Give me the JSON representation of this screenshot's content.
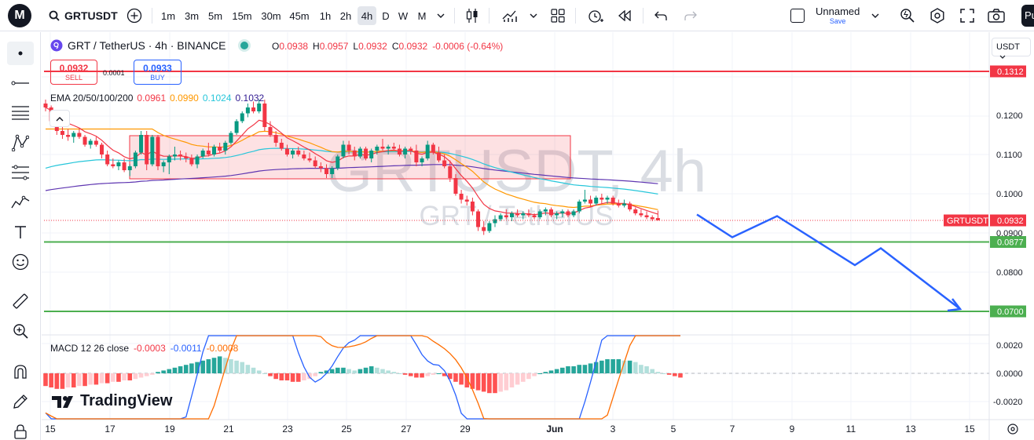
{
  "toolbar": {
    "logo": "M",
    "symbol": "GRTUSDT",
    "intervals": [
      "1m",
      "3m",
      "5m",
      "15m",
      "30m",
      "45m",
      "1h",
      "2h",
      "4h",
      "D",
      "W",
      "M"
    ],
    "active_interval": "4h",
    "layout_name": "Unnamed",
    "layout_status": "Save",
    "publish_label": "Pu"
  },
  "legend": {
    "title": "GRT / TetherUS · 4h · BINANCE",
    "open_label": "O",
    "open": "0.0938",
    "high_label": "H",
    "high": "0.0957",
    "low_label": "L",
    "low": "0.0932",
    "close_label": "C",
    "close": "0.0932",
    "change": "-0.0006 (-0.64%)"
  },
  "trade": {
    "sell_price": "0.0932",
    "sell_label": "SELL",
    "spread": "0.0001",
    "buy_price": "0.0933",
    "buy_label": "BUY"
  },
  "ema": {
    "label": "EMA 20/50/100/200",
    "v20": "0.0961",
    "v50": "0.0990",
    "v100": "0.1024",
    "v200": "0.1032",
    "colors": {
      "ema20": "#f23645",
      "ema50": "#ff9800",
      "ema100": "#26c6da",
      "ema200": "#5e35b1"
    }
  },
  "macd": {
    "label": "MACD 12 26 close",
    "hist": "-0.0003",
    "macd": "-0.0011",
    "signal": "-0.0008",
    "scale_labels": [
      "0.0020",
      "0.0000",
      "-0.0020"
    ]
  },
  "price_scale": {
    "currency": "USDT",
    "ticks": [
      "0.1200",
      "0.1100",
      "0.1000",
      "0.0900",
      "0.0800"
    ],
    "level_red": "0.1312",
    "level_green_1": "0.0877",
    "level_green_2": "0.0700",
    "current_symbol": "GRTUSDT",
    "current_price": "0.0932"
  },
  "time_axis": [
    "15",
    "17",
    "19",
    "21",
    "23",
    "25",
    "27",
    "29",
    "Jun",
    "3",
    "5",
    "7",
    "9",
    "11",
    "13",
    "15"
  ],
  "watermark": {
    "big": "GRTUSDT, 4h",
    "small": "GRT / TetherUS"
  },
  "branding": "TradingView",
  "colors": {
    "up": "#089981",
    "down": "#f23645",
    "level_red": "#f23645",
    "level_green": "#4caf50",
    "projection": "#2962ff"
  },
  "chart_data": {
    "type": "candlestick",
    "title": "GRT / TetherUS · 4h · BINANCE",
    "ylim": [
      0.0695,
      0.1325
    ],
    "horizontal_levels": [
      0.1312,
      0.0877,
      0.07
    ],
    "candles": [
      [
        0.123,
        0.124,
        0.121,
        0.122
      ],
      [
        0.122,
        0.1225,
        0.118,
        0.1185
      ],
      [
        0.1185,
        0.1195,
        0.115,
        0.116
      ],
      [
        0.116,
        0.1175,
        0.114,
        0.115
      ],
      [
        0.115,
        0.1165,
        0.1135,
        0.1145
      ],
      [
        0.1145,
        0.116,
        0.113,
        0.1155
      ],
      [
        0.1155,
        0.1165,
        0.114,
        0.1145
      ],
      [
        0.1145,
        0.115,
        0.112,
        0.1125
      ],
      [
        0.1125,
        0.114,
        0.1115,
        0.1135
      ],
      [
        0.1135,
        0.1145,
        0.112,
        0.1125
      ],
      [
        0.1125,
        0.113,
        0.109,
        0.11
      ],
      [
        0.11,
        0.111,
        0.107,
        0.1075
      ],
      [
        0.1075,
        0.109,
        0.1065,
        0.107
      ],
      [
        0.107,
        0.1085,
        0.106,
        0.108
      ],
      [
        0.108,
        0.109,
        0.1055,
        0.106
      ],
      [
        0.106,
        0.1075,
        0.1045,
        0.107
      ],
      [
        0.107,
        0.111,
        0.1065,
        0.1105
      ],
      [
        0.1105,
        0.116,
        0.11,
        0.115
      ],
      [
        0.115,
        0.116,
        0.106,
        0.1075
      ],
      [
        0.1075,
        0.115,
        0.107,
        0.1145
      ],
      [
        0.1145,
        0.115,
        0.106,
        0.107
      ],
      [
        0.107,
        0.1085,
        0.1055,
        0.108
      ],
      [
        0.108,
        0.11,
        0.105,
        0.1095
      ],
      [
        0.1095,
        0.112,
        0.1085,
        0.11
      ],
      [
        0.11,
        0.111,
        0.1085,
        0.1095
      ],
      [
        0.1095,
        0.1105,
        0.108,
        0.109
      ],
      [
        0.109,
        0.11,
        0.107,
        0.1075
      ],
      [
        0.1075,
        0.11,
        0.1065,
        0.1095
      ],
      [
        0.1095,
        0.1115,
        0.109,
        0.111
      ],
      [
        0.111,
        0.113,
        0.1095,
        0.11
      ],
      [
        0.11,
        0.1125,
        0.1095,
        0.112
      ],
      [
        0.112,
        0.113,
        0.1105,
        0.111
      ],
      [
        0.111,
        0.1135,
        0.11,
        0.113
      ],
      [
        0.113,
        0.116,
        0.1125,
        0.1155
      ],
      [
        0.1155,
        0.119,
        0.115,
        0.1185
      ],
      [
        0.1185,
        0.121,
        0.118,
        0.1205
      ],
      [
        0.1205,
        0.123,
        0.1195,
        0.122
      ],
      [
        0.122,
        0.1235,
        0.1205,
        0.121
      ],
      [
        0.121,
        0.124,
        0.1205,
        0.123
      ],
      [
        0.123,
        0.124,
        0.116,
        0.117
      ],
      [
        0.117,
        0.1185,
        0.1145,
        0.115
      ],
      [
        0.115,
        0.116,
        0.112,
        0.113
      ],
      [
        0.113,
        0.114,
        0.111,
        0.1115
      ],
      [
        0.1115,
        0.1125,
        0.1095,
        0.11
      ],
      [
        0.11,
        0.1115,
        0.109,
        0.111
      ],
      [
        0.111,
        0.112,
        0.1095,
        0.11
      ],
      [
        0.11,
        0.111,
        0.1085,
        0.109
      ],
      [
        0.109,
        0.1105,
        0.108,
        0.1085
      ],
      [
        0.1085,
        0.1095,
        0.1065,
        0.107
      ],
      [
        0.107,
        0.108,
        0.1055,
        0.1065
      ],
      [
        0.1065,
        0.1075,
        0.104,
        0.105
      ],
      [
        0.105,
        0.107,
        0.104,
        0.1065
      ],
      [
        0.1065,
        0.11,
        0.106,
        0.1095
      ],
      [
        0.1095,
        0.1135,
        0.109,
        0.1125
      ],
      [
        0.1125,
        0.1135,
        0.11,
        0.111
      ],
      [
        0.111,
        0.112,
        0.1085,
        0.1095
      ],
      [
        0.1095,
        0.112,
        0.109,
        0.1115
      ],
      [
        0.1115,
        0.112,
        0.1085,
        0.109
      ],
      [
        0.109,
        0.1115,
        0.108,
        0.111
      ],
      [
        0.111,
        0.1125,
        0.11,
        0.112
      ],
      [
        0.112,
        0.114,
        0.111,
        0.1115
      ],
      [
        0.1115,
        0.1125,
        0.11,
        0.112
      ],
      [
        0.112,
        0.113,
        0.111,
        0.1115
      ],
      [
        0.1115,
        0.1125,
        0.1095,
        0.11
      ],
      [
        0.11,
        0.112,
        0.109,
        0.1115
      ],
      [
        0.1115,
        0.112,
        0.11,
        0.111
      ],
      [
        0.111,
        0.1125,
        0.107,
        0.108
      ],
      [
        0.108,
        0.1095,
        0.107,
        0.109
      ],
      [
        0.109,
        0.1135,
        0.1085,
        0.1125
      ],
      [
        0.1125,
        0.113,
        0.11,
        0.1105
      ],
      [
        0.1105,
        0.112,
        0.108,
        0.1085
      ],
      [
        0.1085,
        0.11,
        0.1065,
        0.107
      ],
      [
        0.107,
        0.1085,
        0.103,
        0.104
      ],
      [
        0.104,
        0.105,
        0.0995,
        0.1
      ],
      [
        0.1,
        0.101,
        0.0975,
        0.0985
      ],
      [
        0.0985,
        0.0995,
        0.097,
        0.098
      ],
      [
        0.098,
        0.099,
        0.0945,
        0.0955
      ],
      [
        0.0955,
        0.096,
        0.0905,
        0.0915
      ],
      [
        0.0915,
        0.093,
        0.0895,
        0.0905
      ],
      [
        0.0905,
        0.093,
        0.09,
        0.0925
      ],
      [
        0.0925,
        0.0945,
        0.0915,
        0.0935
      ],
      [
        0.0935,
        0.095,
        0.093,
        0.0945
      ],
      [
        0.0945,
        0.096,
        0.0935,
        0.094
      ],
      [
        0.094,
        0.0955,
        0.093,
        0.095
      ],
      [
        0.095,
        0.096,
        0.094,
        0.0945
      ],
      [
        0.0945,
        0.0955,
        0.0935,
        0.095
      ],
      [
        0.095,
        0.096,
        0.094,
        0.0945
      ],
      [
        0.0945,
        0.095,
        0.0935,
        0.094
      ],
      [
        0.094,
        0.096,
        0.0935,
        0.0955
      ],
      [
        0.0955,
        0.0965,
        0.0945,
        0.096
      ],
      [
        0.096,
        0.0965,
        0.094,
        0.0945
      ],
      [
        0.0945,
        0.0955,
        0.0935,
        0.095
      ],
      [
        0.095,
        0.096,
        0.094,
        0.0955
      ],
      [
        0.0955,
        0.096,
        0.094,
        0.0945
      ],
      [
        0.0945,
        0.096,
        0.094,
        0.0955
      ],
      [
        0.0955,
        0.0985,
        0.095,
        0.098
      ],
      [
        0.098,
        0.101,
        0.0975,
        0.0985
      ],
      [
        0.0985,
        0.0995,
        0.0965,
        0.0975
      ],
      [
        0.0975,
        0.0995,
        0.097,
        0.099
      ],
      [
        0.099,
        0.1,
        0.0975,
        0.0985
      ],
      [
        0.0985,
        0.0995,
        0.0975,
        0.099
      ],
      [
        0.099,
        0.0995,
        0.097,
        0.0975
      ],
      [
        0.0975,
        0.0985,
        0.0965,
        0.097
      ],
      [
        0.097,
        0.0985,
        0.0965,
        0.0975
      ],
      [
        0.0975,
        0.098,
        0.0955,
        0.096
      ],
      [
        0.096,
        0.0965,
        0.0945,
        0.095
      ],
      [
        0.095,
        0.096,
        0.094,
        0.0945
      ],
      [
        0.0945,
        0.0955,
        0.0935,
        0.094
      ],
      [
        0.094,
        0.0945,
        0.093,
        0.0935
      ],
      [
        0.0938,
        0.0957,
        0.0932,
        0.0932
      ]
    ],
    "projection_path_prices": [
      0.0947,
      0.0889,
      0.0943,
      0.0818,
      0.0861,
      0.0706
    ],
    "macd_hist": [
      -0.0009,
      -0.001,
      -0.0011,
      -0.0011,
      -0.001,
      -0.001,
      -0.0009,
      -0.0009,
      -0.0008,
      -0.0008,
      -0.0007,
      -0.0007,
      -0.0006,
      -0.0006,
      -0.0005,
      -0.0005,
      -0.0004,
      -0.0003,
      -0.0002,
      -0.0001,
      0.0001,
      0.0002,
      0.0003,
      0.0004,
      0.0005,
      0.0006,
      0.0007,
      0.0008,
      0.0009,
      0.001,
      0.0011,
      0.0012,
      0.0011,
      0.001,
      0.0009,
      0.0008,
      0.0006,
      0.0004,
      0.0002,
      0.0,
      -0.0002,
      -0.0004,
      -0.0005,
      -0.0005,
      -0.0006,
      -0.0006,
      -0.0005,
      -0.0004,
      -0.0002,
      0.0001,
      0.0002,
      0.0003,
      0.0004,
      0.0004,
      0.0003,
      0.0002,
      0.0003,
      0.0004,
      0.0005,
      0.0004,
      0.0003,
      0.0002,
      0.0001,
      0.0,
      -0.0001,
      -0.0002,
      -0.0003,
      -0.0003,
      -0.0002,
      -0.0001,
      0.0,
      -0.0002,
      -0.0004,
      -0.0006,
      -0.0008,
      -0.001,
      -0.0011,
      -0.0012,
      -0.0013,
      -0.0014,
      -0.0014,
      -0.0013,
      -0.0012,
      -0.001,
      -0.0008,
      -0.0006,
      -0.0004,
      -0.0002,
      0.0,
      0.0001,
      0.0002,
      0.0003,
      0.0004,
      0.0005,
      0.0005,
      0.0006,
      0.0006,
      0.0007,
      0.0008,
      0.0009,
      0.001,
      0.001,
      0.001,
      0.0009,
      0.0009,
      0.0008,
      0.0006,
      0.0005,
      0.0003,
      0.0001,
      0.0,
      -0.0001,
      -0.0002,
      -0.0003
    ]
  }
}
